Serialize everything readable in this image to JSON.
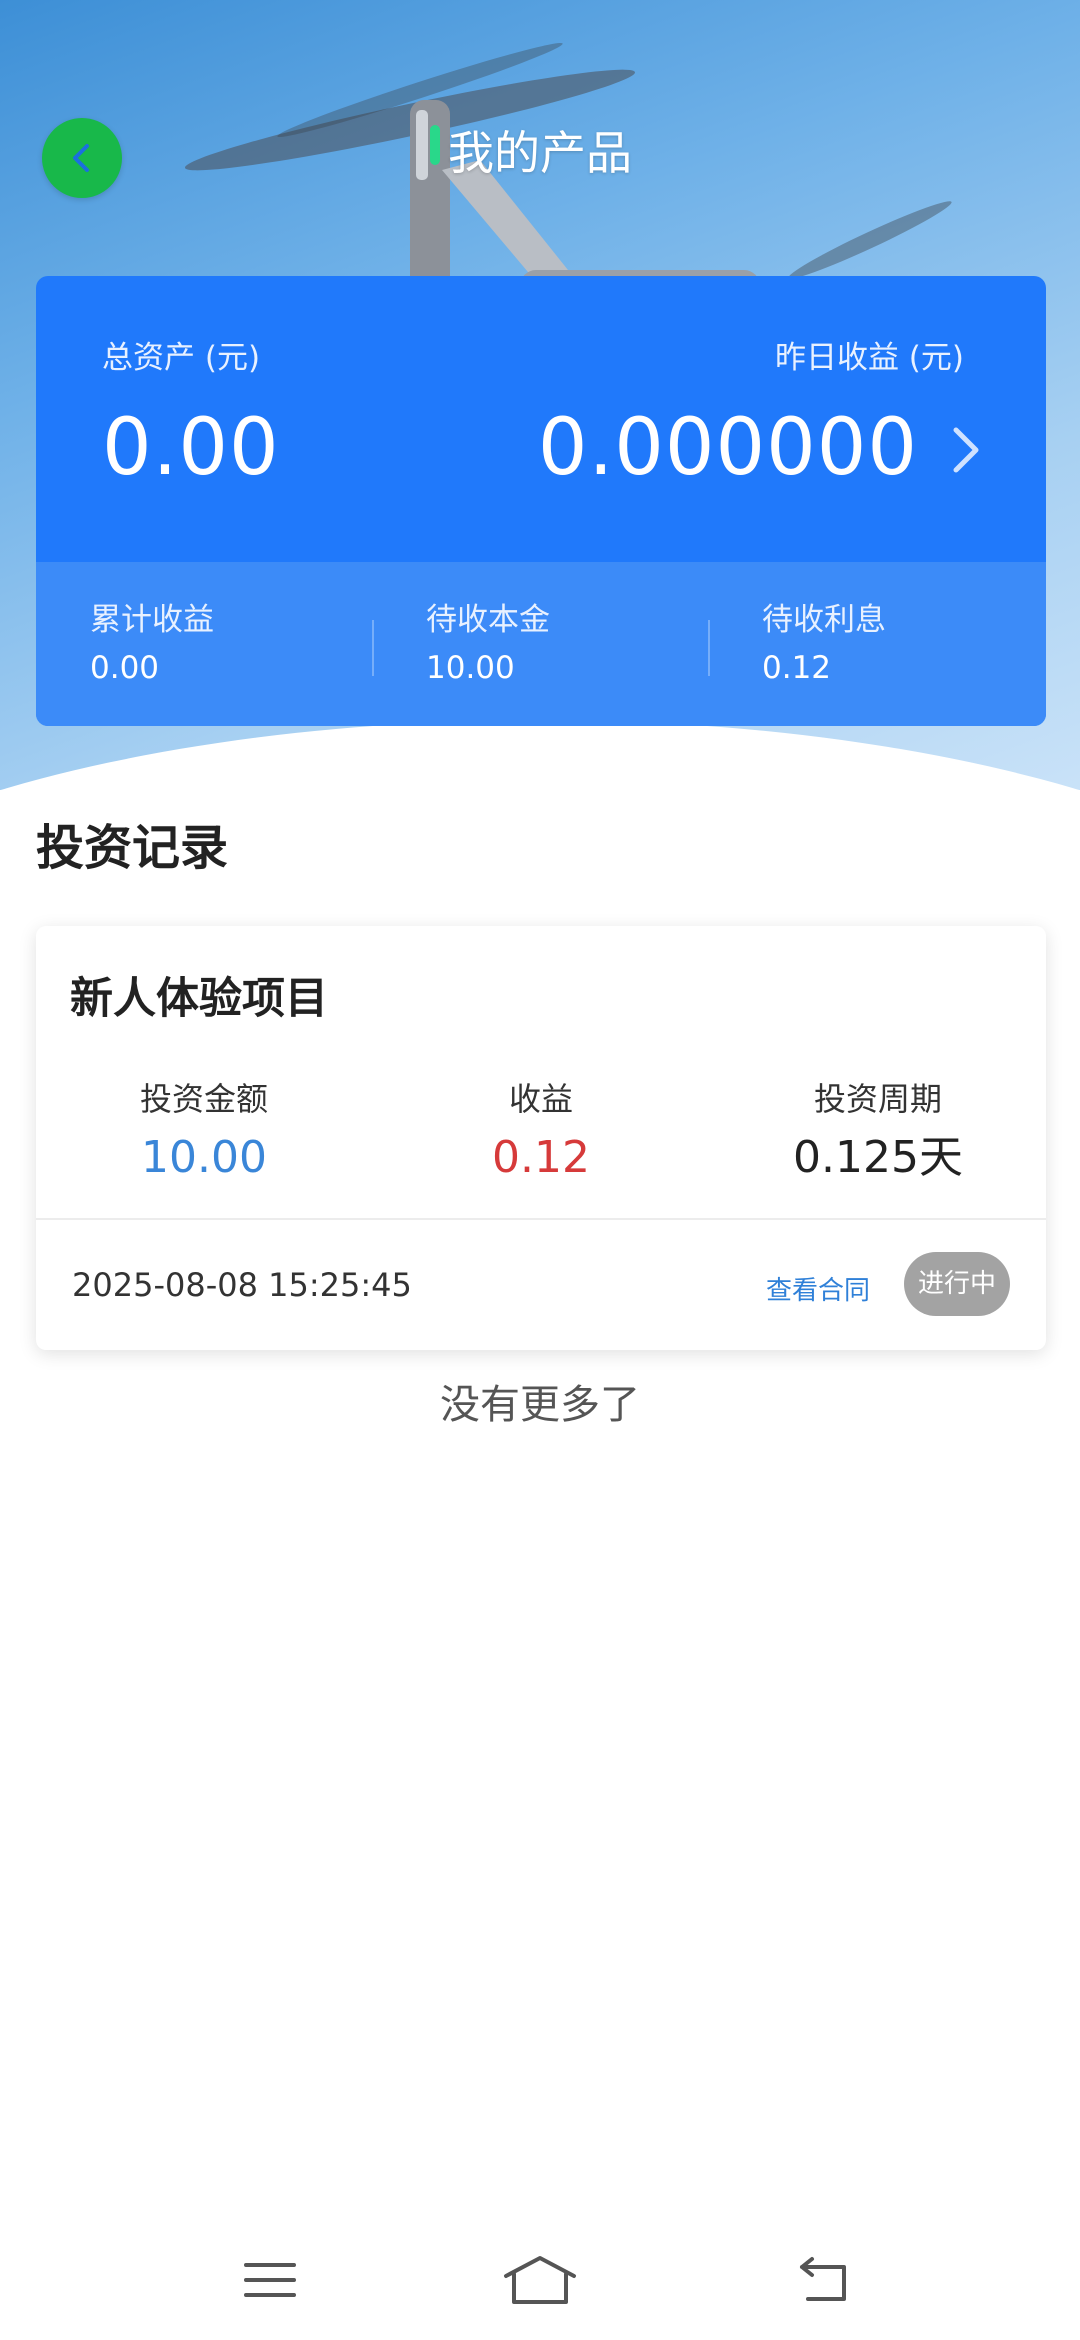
{
  "header": {
    "title": "我的产品"
  },
  "assets": {
    "total_label": "总资产 (元)",
    "total_value": "0.00",
    "yesterday_label": "昨日收益 (元)",
    "yesterday_value": "0.000000",
    "stats": [
      {
        "label": "累计收益",
        "value": "0.00"
      },
      {
        "label": "待收本金",
        "value": "10.00"
      },
      {
        "label": "待收利息",
        "value": "0.12"
      }
    ]
  },
  "records": {
    "section_title": "投资记录",
    "items": [
      {
        "name": "新人体验项目",
        "amount_label": "投资金额",
        "amount_value": "10.00",
        "income_label": "收益",
        "income_value": "0.12",
        "period_label": "投资周期",
        "period_value": "0.125天",
        "time": "2025-08-08 15:25:45",
        "contract_link": "查看合同",
        "status": "进行中"
      }
    ],
    "no_more": "没有更多了"
  },
  "colors": {
    "accent": "#2079fb",
    "amount": "#3a86d8",
    "income": "#d63a3a",
    "back_button": "#18b84a",
    "status_pill": "#a3a3a3"
  },
  "icons": {
    "back": "chevron-left-icon",
    "detail": "chevron-right-icon",
    "nav_menu": "menu-icon",
    "nav_home": "home-icon",
    "nav_back": "back-arrow-icon"
  }
}
